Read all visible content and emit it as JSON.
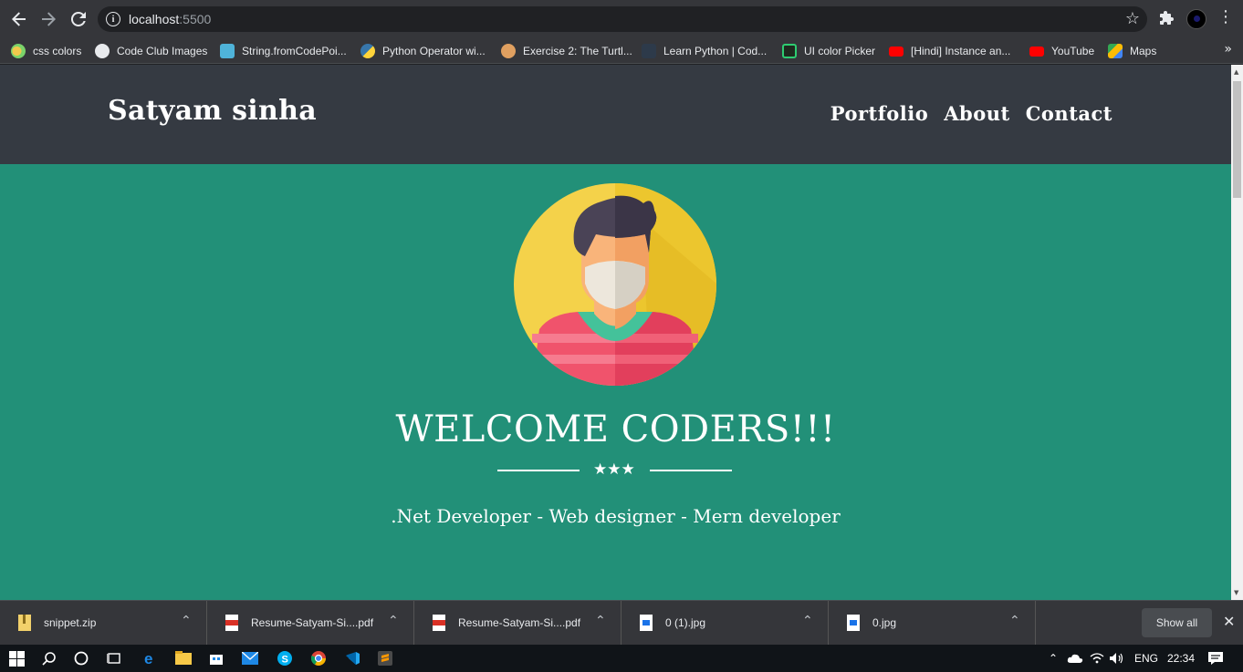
{
  "browser": {
    "url_host": "localhost",
    "url_port": ":5500"
  },
  "bookmarks": [
    {
      "label": "css colors",
      "color": "#f2c94c"
    },
    {
      "label": "Code Club Images",
      "color": "#ffffff"
    },
    {
      "label": "String.fromCodePoi...",
      "color": "#4fb3d9"
    },
    {
      "label": "Python Operator wi...",
      "color": "#3776ab"
    },
    {
      "label": "Exercise 2: The Turtl...",
      "color": "#e0a060"
    },
    {
      "label": "Learn Python | Cod...",
      "color": "#2d3a4a"
    },
    {
      "label": "UI color Picker",
      "color": "#2ecc71"
    },
    {
      "label": "[Hindi] Instance an...",
      "color": "#ff0000"
    },
    {
      "label": "YouTube",
      "color": "#ff0000"
    },
    {
      "label": "Maps",
      "color": "#34a853"
    }
  ],
  "site": {
    "brand": "Satyam sinha",
    "nav": [
      "Portfolio",
      "About",
      "Contact"
    ],
    "welcome": "WELCOME CODERS!!!",
    "stars": "★★★",
    "subtitle": ".Net Developer - Web designer - Mern developer",
    "colors": {
      "nav_bg": "#353a42",
      "hero_bg": "#229078"
    }
  },
  "downloads": [
    {
      "name": "snippet.zip",
      "icon": "zip-file-icon"
    },
    {
      "name": "Resume-Satyam-Si....pdf",
      "icon": "pdf-file-icon"
    },
    {
      "name": "Resume-Satyam-Si....pdf",
      "icon": "pdf-file-icon"
    },
    {
      "name": "0 (1).jpg",
      "icon": "image-file-icon"
    },
    {
      "name": "0.jpg",
      "icon": "image-file-icon"
    }
  ],
  "shelf": {
    "show_all": "Show all"
  },
  "taskbar": {
    "lang": "ENG",
    "time": "22:34"
  }
}
